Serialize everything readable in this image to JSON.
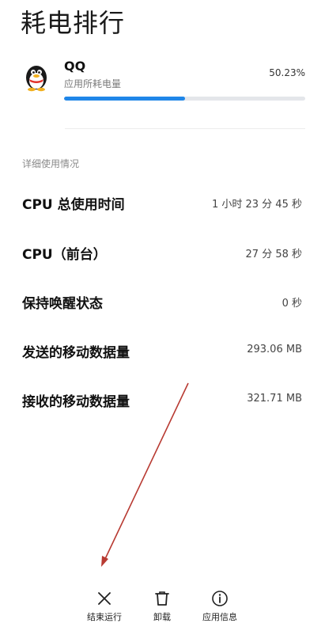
{
  "page": {
    "title": "耗电排行"
  },
  "app": {
    "name": "QQ",
    "subtitle": "应用所耗电量",
    "percent_text": "50.23%",
    "usage_fraction": 0.5023,
    "icon": "qq-penguin-icon"
  },
  "details": {
    "section_title": "详细使用情况",
    "rows": [
      {
        "label": "CPU 总使用时间",
        "value": "1 小时 23 分 45 秒"
      },
      {
        "label": "CPU（前台）",
        "value": "27 分 58 秒"
      },
      {
        "label": "保持唤醒状态",
        "value": "0 秒"
      },
      {
        "label": "发送的移动数据量",
        "value": "293.06 MB"
      },
      {
        "label": "接收的移动数据量",
        "value": "321.71 MB"
      }
    ]
  },
  "actions": {
    "stop": {
      "label": "结束运行",
      "icon": "close-icon"
    },
    "uninstall": {
      "label": "卸载",
      "icon": "trash-icon"
    },
    "app_info": {
      "label": "应用信息",
      "icon": "info-icon"
    }
  },
  "colors": {
    "accent": "#1f86e8",
    "annotation_arrow": "#b83a32"
  }
}
